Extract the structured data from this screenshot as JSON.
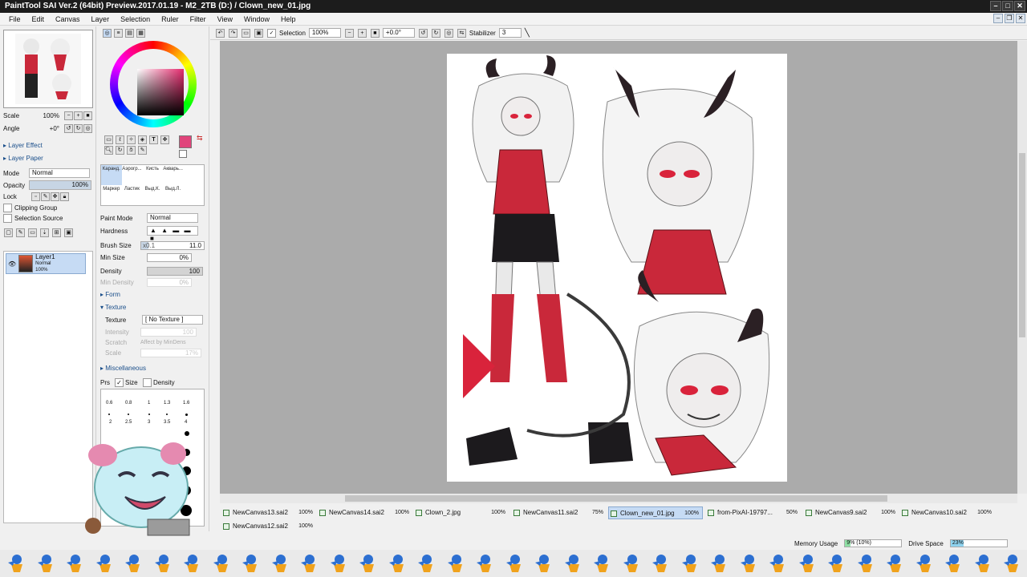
{
  "window": {
    "title": "PaintTool SAI Ver.2 (64bit) Preview.2017.01.19 - M2_2TB (D:) / Clown_new_01.jpg"
  },
  "menu": [
    "File",
    "Edit",
    "Canvas",
    "Layer",
    "Selection",
    "Ruler",
    "Filter",
    "View",
    "Window",
    "Help"
  ],
  "navigator": {
    "scale_label": "Scale",
    "scale_value": "100%",
    "angle_label": "Angle",
    "angle_value": "+0°"
  },
  "layer_panel": {
    "effect": "Layer Effect",
    "paper": "Layer Paper",
    "mode_label": "Mode",
    "mode_value": "Normal",
    "opacity_label": "Opacity",
    "opacity_value": "100%",
    "lock_label": "Lock",
    "clipping_group": "Clipping Group",
    "selection_source": "Selection Source",
    "layer_name": "Layer1",
    "layer_mode": "Normal",
    "layer_opacity": "100%"
  },
  "brushes": [
    "Каранд.",
    "Аэрогр...",
    "Кисть",
    "Акварь...",
    "",
    "Маркер",
    "Ластик",
    "Выд.К.",
    "Выд.Л.",
    ""
  ],
  "tool_props": {
    "paint_mode_label": "Paint Mode",
    "paint_mode_value": "Normal",
    "hardness_label": "Hardness",
    "brush_size_label": "Brush Size",
    "brush_size_mult": "x0.1",
    "brush_size_value": "11.0",
    "min_size_label": "Min Size",
    "min_size_value": "0%",
    "density_label": "Density",
    "density_value": "100",
    "min_density_label": "Min Density",
    "min_density_value": "0%",
    "form_label": "Form",
    "texture_section": "Texture",
    "texture_label": "Texture",
    "texture_value": "[ No Texture ]",
    "intensity_label": "Intensity",
    "intensity_value": "100",
    "scratch_label": "Scratch",
    "affect_label": "Affect by MinDens",
    "scale_label": "Scale",
    "scale_value": "17%",
    "misc_label": "Miscellaneous",
    "prs_label": "Prs",
    "size_label": "Size",
    "density_chk_label": "Density"
  },
  "dot_sizes": [
    "0.6",
    "0.8",
    "1",
    "1.3",
    "1.6",
    "2",
    "2.5",
    "3",
    "3.5",
    "4"
  ],
  "toolbar": {
    "selection_label": "Selection",
    "zoom_value": "100%",
    "angle_value": "+0.0°",
    "stabilizer_label": "Stabilizer",
    "stabilizer_value": "3"
  },
  "tabs": [
    {
      "name": "NewCanvas13.sai2",
      "pct": "100%"
    },
    {
      "name": "NewCanvas14.sai2",
      "pct": "100%"
    },
    {
      "name": "Clown_2.jpg",
      "pct": "100%"
    },
    {
      "name": "NewCanvas11.sai2",
      "pct": "75%"
    },
    {
      "name": "Clown_new_01.jpg",
      "pct": "100%"
    },
    {
      "name": "from-PixAI-19797...",
      "pct": "50%"
    },
    {
      "name": "NewCanvas9.sai2",
      "pct": "100%"
    },
    {
      "name": "NewCanvas10.sai2",
      "pct": "100%"
    },
    {
      "name": "NewCanvas12.sai2",
      "pct": "100%"
    }
  ],
  "status": {
    "memory_label": "Memory Usage",
    "memory_value": "9% (10%)",
    "memory_fraction": 0.09,
    "drive_label": "Drive Space",
    "drive_value": "23%",
    "drive_fraction": 0.23
  },
  "colors": {
    "accent": "#c6dbf4",
    "primary_color": "#e0457b",
    "section": "#1a4e8a"
  }
}
